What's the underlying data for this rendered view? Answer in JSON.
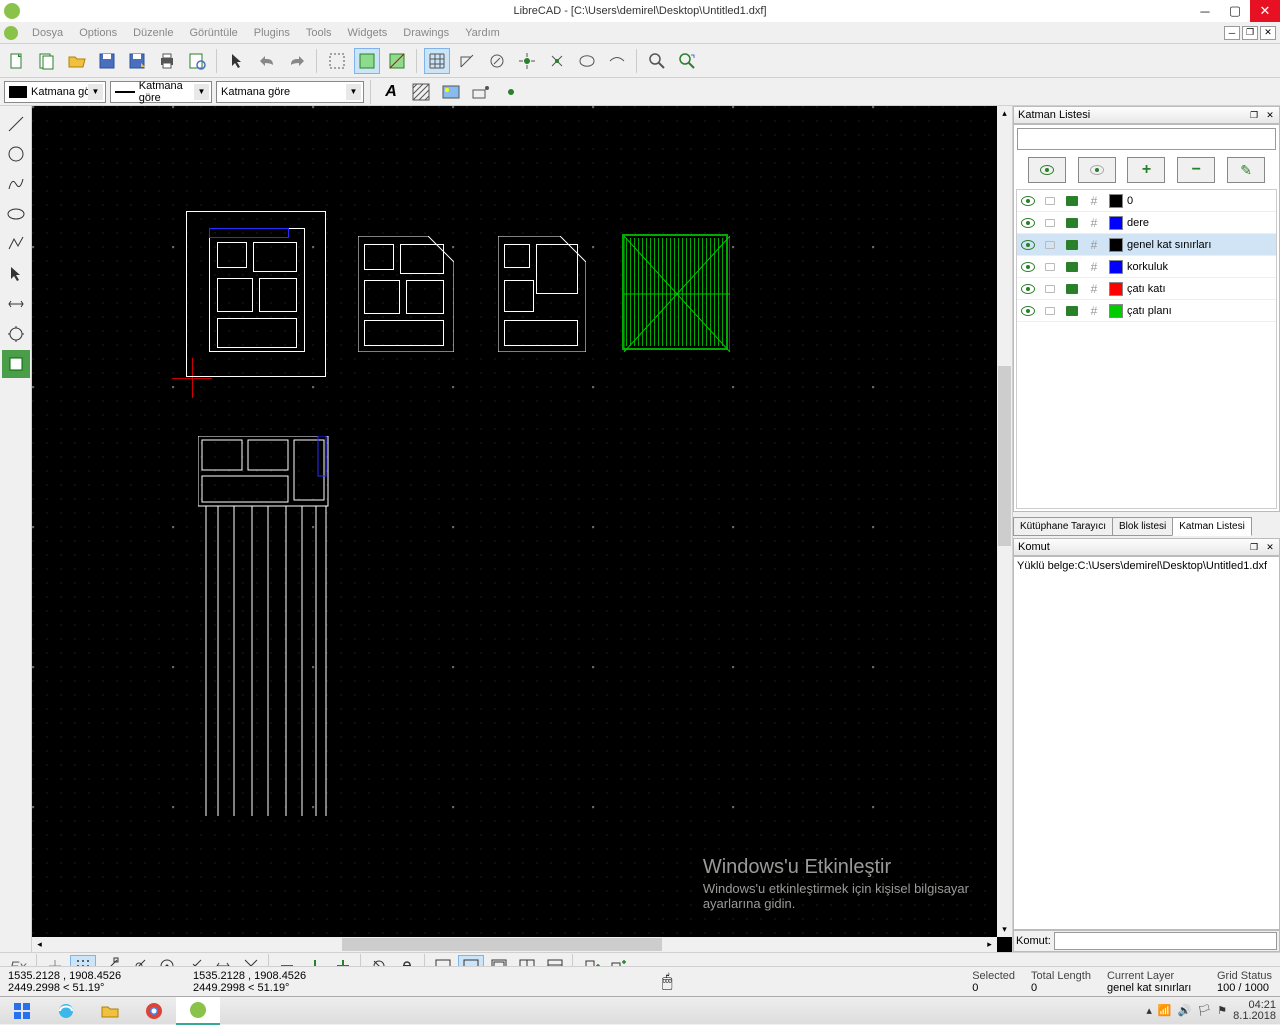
{
  "window": {
    "title": "LibreCAD - [C:\\Users\\demirel\\Desktop\\Untitled1.dxf]"
  },
  "menu": {
    "items": [
      "Dosya",
      "Options",
      "Düzenle",
      "Görüntüle",
      "Plugins",
      "Tools",
      "Widgets",
      "Drawings",
      "Yardım"
    ]
  },
  "properties": {
    "color": "Katmana göre",
    "linewidth": "Katmana göre",
    "linetype": "Katmana göre"
  },
  "layerPanel": {
    "title": "Katman Listesi",
    "layers": [
      {
        "name": "0",
        "color": "#000000"
      },
      {
        "name": "dere",
        "color": "#0000ff"
      },
      {
        "name": "genel kat sınırları",
        "color": "#000000"
      },
      {
        "name": "korkuluk",
        "color": "#0000ff"
      },
      {
        "name": "çatı katı",
        "color": "#ff0000"
      },
      {
        "name": "çatı planı",
        "color": "#00cc00"
      }
    ],
    "tabs": [
      "Kütüphane Tarayıcı",
      "Blok listesi",
      "Katman Listesi"
    ]
  },
  "commandPanel": {
    "title": "Komut",
    "output": "Yüklü belge:C:\\Users\\demirel\\Desktop\\Untitled1.dxf",
    "prompt": "Komut:"
  },
  "status": {
    "abs_coord": "1535.2128 , 1908.4526",
    "polar_coord": "2449.2998 < 51.19°",
    "abs_coord2": "1535.2128 , 1908.4526",
    "polar_coord2": "2449.2998 < 51.19°",
    "selected_label": "Selected",
    "selected_value": "0",
    "total_label": "Total Length",
    "total_value": "0",
    "curlayer_label": "Current Layer",
    "curlayer_value": "genel kat sınırları",
    "grid_label": "Grid Status",
    "grid_value": "100 / 1000"
  },
  "bottomToolbar": {
    "ex": "Ex"
  },
  "watermark": {
    "title": "Windows'u Etkinleştir",
    "line1": "Windows'u etkinleştirmek için kişisel bilgisayar",
    "line2": "ayarlarına gidin."
  },
  "tray": {
    "time": "04:21",
    "date": "8.1.2018"
  }
}
